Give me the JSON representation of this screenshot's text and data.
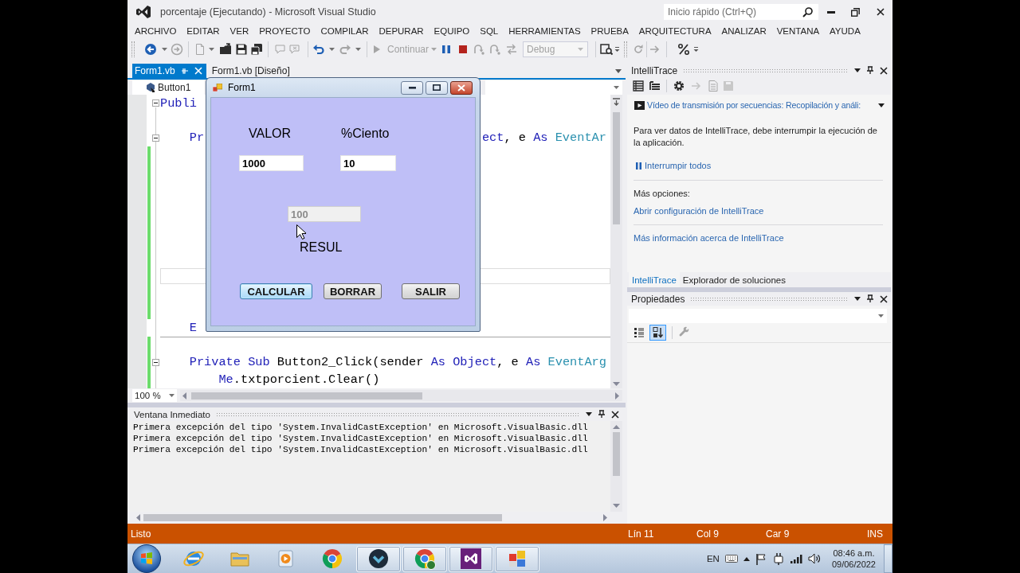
{
  "window": {
    "title": "porcentaje (Ejecutando) - Microsoft Visual Studio",
    "quick_launch": {
      "placeholder": "Inicio rápido (Ctrl+Q)"
    }
  },
  "menu": [
    "ARCHIVO",
    "EDITAR",
    "VER",
    "PROYECTO",
    "COMPILAR",
    "DEPURAR",
    "EQUIPO",
    "SQL",
    "HERRAMIENTAS",
    "PRUEBA",
    "ARQUITECTURA",
    "ANALIZAR",
    "VENTANA",
    "AYUDA"
  ],
  "toolbar": {
    "continue": {
      "label": "Continuar",
      "disabled": true
    },
    "configuration": {
      "value": "Debug",
      "disabled": true
    }
  },
  "document_tabs": [
    {
      "label": "Form1.vb",
      "selected": true
    },
    {
      "label": "Form1.vb [Diseño]",
      "selected": false
    }
  ],
  "navigation": {
    "class": "Button1"
  },
  "editor": {
    "lines": [
      {
        "kind": "code",
        "tokens": [
          {
            "text": "Publi",
            "kind": "keyword"
          }
        ],
        "expanded": true,
        "changed": false,
        "current": false,
        "children": [
          {
            "kind": "blank",
            "changed": false,
            "current": false
          },
          {
            "kind": "code",
            "tokens": [
              {
                "text": "Pr",
                "kind": "keyword"
              }
            ],
            "right_tokens": [
              {
                "text": "ect",
                "kind": "keyword"
              },
              {
                "text": ", e ",
                "kind": "plain"
              },
              {
                "text": "As",
                "kind": "keyword"
              },
              {
                "text": " EventAr",
                "kind": "type"
              }
            ],
            "expanded": true,
            "changed": false,
            "current": false,
            "children": [
              {
                "kind": "blank",
                "changed": true,
                "current": false
              },
              {
                "kind": "blank",
                "changed": true,
                "current": false
              },
              {
                "kind": "blank",
                "changed": true,
                "current": false
              },
              {
                "kind": "blank",
                "changed": true,
                "current": false
              },
              {
                "kind": "blank",
                "changed": true,
                "current": false
              },
              {
                "kind": "blank",
                "changed": true,
                "current": false
              },
              {
                "kind": "blank",
                "changed": true,
                "current": false
              },
              {
                "kind": "blank",
                "changed": true,
                "current": true
              },
              {
                "kind": "blank",
                "changed": true,
                "current": false
              },
              {
                "kind": "blank",
                "changed": true,
                "current": false
              }
            ]
          },
          {
            "kind": "code",
            "tokens": [
              {
                "text": "E",
                "kind": "keyword"
              }
            ],
            "changed": false,
            "current": false
          },
          {
            "kind": "blank",
            "changed": true,
            "current": false
          },
          {
            "kind": "code",
            "tokens": [
              {
                "text": "Private Sub",
                "kind": "keyword"
              },
              {
                "text": " Button2_Click(sender ",
                "kind": "plain"
              },
              {
                "text": "As",
                "kind": "keyword"
              },
              {
                "text": " Object",
                "kind": "keyword"
              },
              {
                "text": ", e ",
                "kind": "plain"
              },
              {
                "text": "As",
                "kind": "keyword"
              },
              {
                "text": " EventArg",
                "kind": "type"
              }
            ],
            "expanded": true,
            "changed": true,
            "current": false,
            "children": [
              {
                "kind": "code",
                "tokens": [
                  {
                    "text": "Me",
                    "kind": "keyword"
                  },
                  {
                    "text": ".txtporcient.Clear()",
                    "kind": "plain"
                  }
                ],
                "changed": true,
                "current": false
              }
            ]
          }
        ]
      }
    ]
  },
  "zoom": {
    "value": "100 %"
  },
  "immediate_window": {
    "title": "Ventana Inmediato",
    "lines": [
      "Primera excepción del tipo 'System.InvalidCastException' en Microsoft.VisualBasic.dll",
      "Primera excepción del tipo 'System.InvalidCastException' en Microsoft.VisualBasic.dll",
      "Primera excepción del tipo 'System.InvalidCastException' en Microsoft.VisualBasic.dll"
    ]
  },
  "intellitrace": {
    "title": "IntelliTrace",
    "video_link": "Vídeo de transmisión por secuencias: Recopilación y análi:",
    "message": "Para ver datos de IntelliTrace, debe interrumpir la ejecución de la aplicación.",
    "break_all": "Interrumpir todos",
    "more_options": "Más opciones:",
    "links": [
      "Abrir configuración de IntelliTrace",
      "Más información acerca de IntelliTrace"
    ]
  },
  "panel_tabs": [
    {
      "label": "IntelliTrace",
      "selected": true
    },
    {
      "label": "Explorador de soluciones",
      "selected": false
    }
  ],
  "properties": {
    "title": "Propiedades",
    "sort_buttons": [
      {
        "kind": "categorized",
        "selected": false
      },
      {
        "kind": "alphabetical",
        "selected": true
      }
    ]
  },
  "form_window": {
    "title": "Form1",
    "captions": [
      "VALOR",
      "%Ciento"
    ],
    "inputs": [
      {
        "value": "1000",
        "disabled": false
      },
      {
        "value": "10",
        "disabled": false
      }
    ],
    "result": {
      "value": "100",
      "disabled": true
    },
    "result_label": "RESUL",
    "buttons": [
      {
        "label": "CALCULAR",
        "focused": true
      },
      {
        "label": "BORRAR",
        "focused": false
      },
      {
        "label": "SALIR",
        "focused": false
      }
    ]
  },
  "status_bar": {
    "message": "Listo",
    "line": "Lín 11",
    "column": "Col 9",
    "character": "Car 9",
    "mode": "INS"
  },
  "taskbar": {
    "apps": [
      {
        "kind": "ebrowser",
        "running": false
      },
      {
        "kind": "folder",
        "running": false
      },
      {
        "kind": "player",
        "running": false
      },
      {
        "kind": "browser",
        "running": false
      },
      {
        "kind": "chevron",
        "running": true
      },
      {
        "kind": "browserbadge",
        "running": true
      },
      {
        "kind": "studio",
        "running": true
      },
      {
        "kind": "tiles",
        "running": true
      }
    ],
    "language": "EN",
    "time": "08:46 a.m.",
    "date": "09/06/2022"
  }
}
